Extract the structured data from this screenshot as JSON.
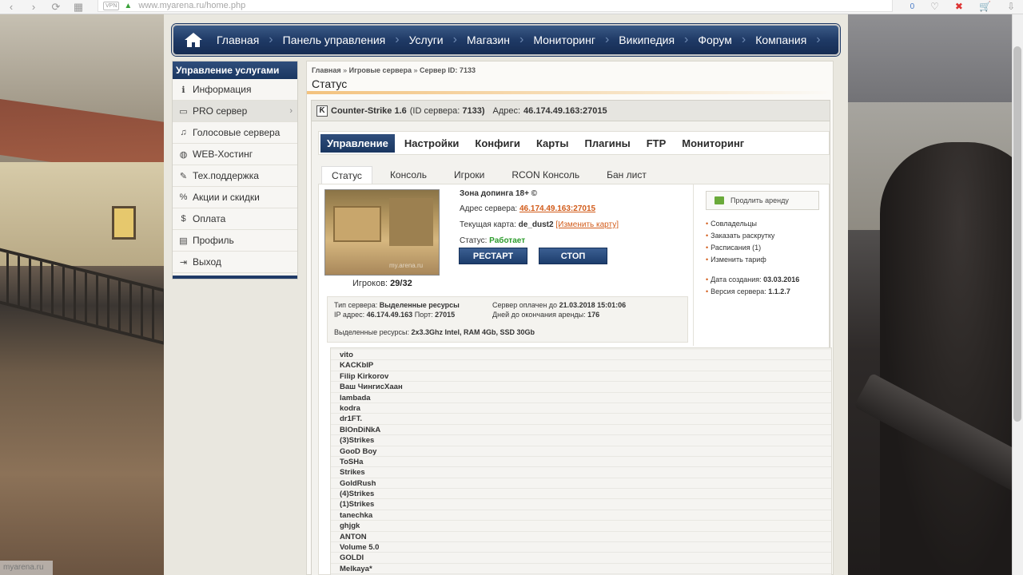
{
  "browser": {
    "url": "www.myarena.ru/home.php",
    "vpn": "VPN",
    "count_badge": "0"
  },
  "nav": {
    "items": [
      "Главная",
      "Панель управления",
      "Услуги",
      "Магазин",
      "Мониторинг",
      "Википедия",
      "Форум",
      "Компания"
    ]
  },
  "sidebar": {
    "title": "Управление услугами",
    "items": [
      {
        "label": "Информация"
      },
      {
        "label": "PRO сервер"
      },
      {
        "label": "Голосовые сервера"
      },
      {
        "label": "WEB-Хостинг"
      },
      {
        "label": "Тех.поддержка"
      },
      {
        "label": "Акции и скидки"
      },
      {
        "label": "Оплата"
      },
      {
        "label": "Профиль"
      },
      {
        "label": "Выход"
      }
    ]
  },
  "breadcrumb": {
    "home": "Главная",
    "section": "Игровые сервера",
    "current": "Сервер ID: 7133"
  },
  "page_title": "Статус",
  "server": {
    "game": "Counter-Strike 1.6",
    "id_label": "(ID сервера:",
    "id_value": "7133)",
    "address_label": "Адрес:",
    "address_value": "46.174.49.163:27015"
  },
  "main_tabs": [
    "Управление",
    "Настройки",
    "Конфиги",
    "Карты",
    "Плагины",
    "FTP",
    "Мониторинг"
  ],
  "sub_tabs": [
    "Статус",
    "Консоль",
    "Игроки",
    "RCON Консоль",
    "Бан лист"
  ],
  "status": {
    "name": "Зона допинга 18+ ©",
    "addr_label": "Адрес сервера:",
    "addr_value": "46.174.49.163:27015",
    "map_label": "Текущая карта:",
    "map_value": "de_dust2",
    "map_change": "[Изменить карту]",
    "state_label": "Статус:",
    "state_value": "Работает",
    "restart_btn": "РЕСТАРТ",
    "stop_btn": "СТОП",
    "players_label": "Игроков:",
    "players_value": "29/32",
    "thumb_watermark": "my.arena.ru"
  },
  "details": {
    "type_label": "Тип сервера:",
    "type_value": "Выделенные ресурсы",
    "ip_label": "IP адрес:",
    "ip_value": "46.174.49.163",
    "port_label": "Порт:",
    "port_value": "27015",
    "paid_label": "Сервер оплачен до",
    "paid_value": "21.03.2018 15:01:06",
    "days_label": "Дней до окончания аренды:",
    "days_value": "176",
    "res_label": "Выделенные ресурсы:",
    "res_value": "2x3.3Ghz Intel, RAM 4Gb, SSD 30Gb"
  },
  "right_col": {
    "renew": "Продлить аренду",
    "links": [
      "Совладельцы",
      "Заказать раскрутку",
      "Расписания (1)",
      "Изменить тариф"
    ],
    "created_label": "Дата создания:",
    "created_value": "03.03.2016",
    "version_label": "Версия сервера:",
    "version_value": "1.1.2.7"
  },
  "players": [
    "vito",
    "KACKbIP",
    "Filip Kirkorov",
    "Ваш ЧингисХаан",
    "lambada",
    "kodra",
    "dr1FT.",
    "BlOnDiNkA",
    "(3)Strikes",
    "GooD Boy",
    "ToSHa",
    "Strikes",
    "GoldRush",
    "(4)Strikes",
    "(1)Strikes",
    "tanechka",
    "ghjgk",
    "ANTON",
    "Volume 5.0",
    "GOLDI",
    "Melkaya*"
  ],
  "statusbar": "myarena.ru"
}
